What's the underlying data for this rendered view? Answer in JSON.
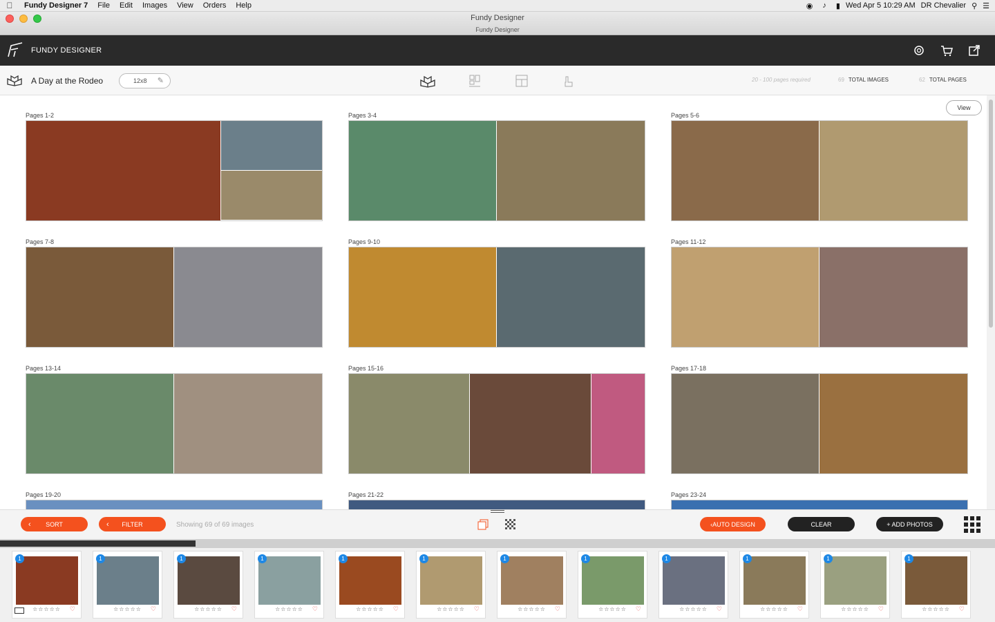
{
  "menubar": {
    "app": "Fundy Designer 7",
    "items": [
      "File",
      "Edit",
      "Images",
      "View",
      "Orders",
      "Help"
    ],
    "datetime": "Wed Apr 5  10:29 AM",
    "user": "DR Chevalier"
  },
  "window": {
    "title": "Fundy Designer",
    "subtitle": "Fundy Designer"
  },
  "header": {
    "brand": "FUNDY DESIGNER"
  },
  "toolbar": {
    "album_title": "A Day at the Rodeo",
    "size": "12x8",
    "requirement": "20 - 100 pages required",
    "total_images_num": "69",
    "total_images_label": "TOTAL IMAGES",
    "total_pages_num": "62",
    "total_pages_label": "TOTAL PAGES"
  },
  "spreads": {
    "view_label": "View",
    "items": [
      {
        "label": "Pages 1-2",
        "colors": [
          "#8a3a22",
          "#6b7f8a",
          "#9a8a6a"
        ]
      },
      {
        "label": "Pages 3-4",
        "colors": [
          "#5a8a6a",
          "#8a7a5a"
        ]
      },
      {
        "label": "Pages 5-6",
        "colors": [
          "#8a6a4a",
          "#b09a70"
        ]
      },
      {
        "label": "Pages 7-8",
        "colors": [
          "#7a5a3a",
          "#8a8a90"
        ]
      },
      {
        "label": "Pages 9-10",
        "colors": [
          "#c08a30",
          "#5a6a70"
        ]
      },
      {
        "label": "Pages 11-12",
        "colors": [
          "#c0a070",
          "#8a7068"
        ]
      },
      {
        "label": "Pages 13-14",
        "colors": [
          "#6a8a6a",
          "#a09080"
        ]
      },
      {
        "label": "Pages 15-16",
        "colors": [
          "#8a8a6a",
          "#6a4a3a",
          "#c05a80"
        ]
      },
      {
        "label": "Pages 17-18",
        "colors": [
          "#7a7060",
          "#9a7040"
        ]
      },
      {
        "label": "Pages 19-20",
        "colors": [
          "#6a90c0"
        ]
      },
      {
        "label": "Pages 21-22",
        "colors": [
          "#405a80"
        ]
      },
      {
        "label": "Pages 23-24",
        "colors": [
          "#3a70b0"
        ]
      }
    ]
  },
  "actions": {
    "sort": "SORT",
    "filter": "FILTER",
    "showing": "Showing 69 of 69 images",
    "auto_design": "AUTO DESIGN",
    "clear": "CLEAR",
    "add_photos": "+ ADD PHOTOS"
  },
  "filmstrip": {
    "badge": "1",
    "stars": "☆☆☆☆☆",
    "items": [
      {
        "color": "#8a3a22"
      },
      {
        "color": "#6b7f8a"
      },
      {
        "color": "#5a4a40"
      },
      {
        "color": "#8aa0a0"
      },
      {
        "color": "#9a4a20"
      },
      {
        "color": "#b09a70"
      },
      {
        "color": "#a08060"
      },
      {
        "color": "#7a9a6a"
      },
      {
        "color": "#6a7080"
      },
      {
        "color": "#8a7a5a"
      },
      {
        "color": "#9aa080"
      },
      {
        "color": "#7a5a3a"
      }
    ]
  }
}
